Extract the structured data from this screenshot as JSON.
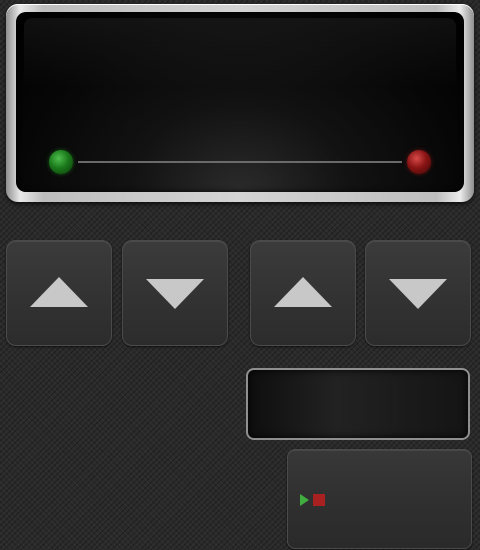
{
  "display": {
    "status_leds": {
      "left": {
        "icon": "green-led",
        "color": "#1b7a1b"
      },
      "right": {
        "icon": "red-led",
        "color": "#8a1414"
      }
    },
    "progress": 0
  },
  "controls": {
    "buttons": [
      {
        "icon": "up-arrow-icon"
      },
      {
        "icon": "down-arrow-icon"
      },
      {
        "icon": "up-arrow-icon"
      },
      {
        "icon": "down-arrow-icon"
      }
    ],
    "run_stop": {
      "icons": [
        "play-icon",
        "stop-icon"
      ],
      "play_color": "#3fae3f",
      "stop_color": "#a82020"
    }
  }
}
